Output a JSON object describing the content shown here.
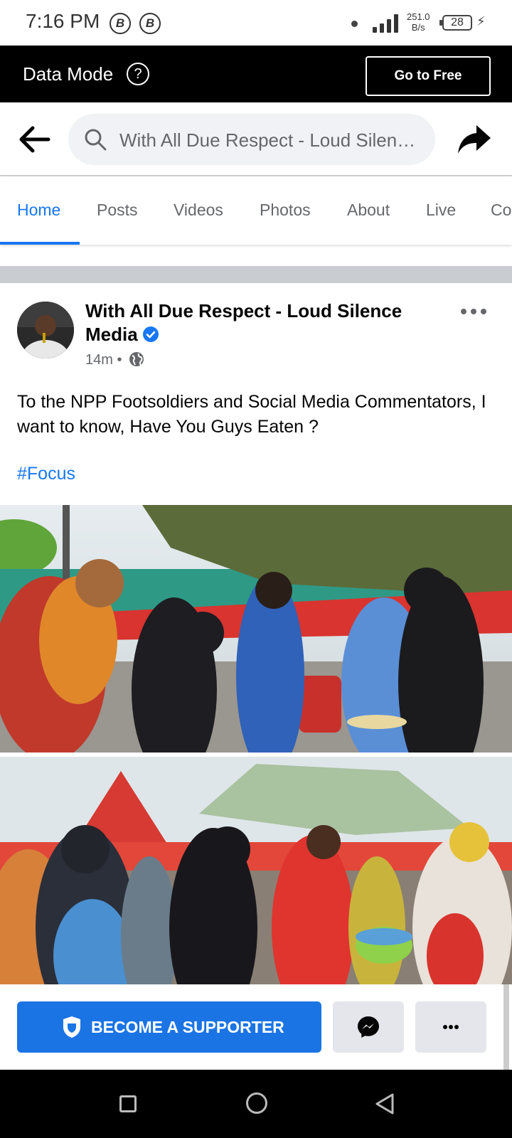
{
  "status_bar": {
    "time": "7:16 PM",
    "notif_icons": [
      "B",
      "B"
    ],
    "speed_value": "251.0",
    "speed_unit": "B/s",
    "battery": "28"
  },
  "data_mode": {
    "label": "Data Mode",
    "help": "?",
    "button": "Go to Free"
  },
  "search": {
    "text": "With All Due Respect - Loud Silence Media"
  },
  "tabs": [
    "Home",
    "Posts",
    "Videos",
    "Photos",
    "About",
    "Live",
    "Co"
  ],
  "post": {
    "author": "With All Due Respect - Loud Silence Media",
    "time": "14m",
    "separator": "•",
    "text": "To the NPP Footsoldiers and Social Media Commentators, I want to know, Have You Guys Eaten ?",
    "hashtag": "#Focus"
  },
  "actions": {
    "supporter": "BECOME A SUPPORTER"
  },
  "colors": {
    "accent": "#1877f2",
    "button_blue": "#1b74e4",
    "secondary_button": "#e4e6eb"
  },
  "icons": [
    "back-arrow-icon",
    "search-icon",
    "share-icon",
    "verified-icon",
    "globe-icon",
    "more-dots-icon",
    "shield-icon",
    "messenger-icon"
  ]
}
